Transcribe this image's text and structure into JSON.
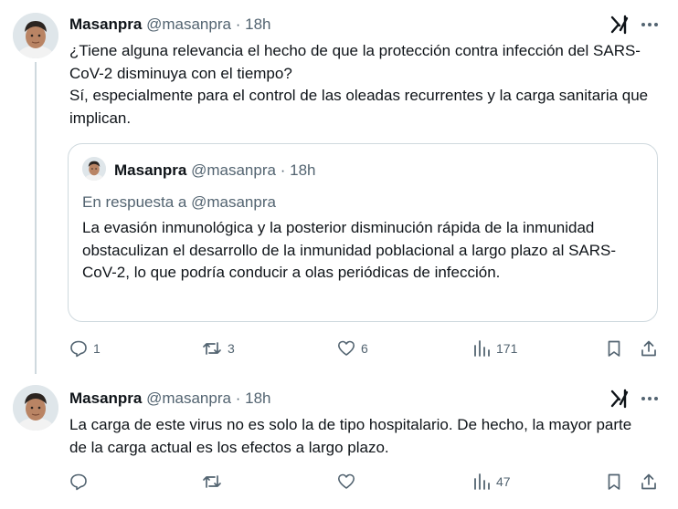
{
  "tweets": [
    {
      "name": "Masanpra",
      "handle": "@masanpra",
      "separator": "·",
      "time": "18h",
      "paragraphs": [
        "¿Tiene alguna relevancia el hecho de que la protección contra infección del SARS-CoV-2 disminuya con el tiempo?",
        "Sí, especialmente para el control de las oleadas recurrentes y la carga sanitaria que implican."
      ],
      "quote": {
        "name": "Masanpra",
        "handle": "@masanpra",
        "separator": "·",
        "time": "18h",
        "reply_prefix": "En respuesta a ",
        "reply_to": "@masanpra",
        "text": "La evasión inmunológica y la posterior disminución rápida de la inmunidad obstaculizan el desarrollo de la inmunidad poblacional a largo plazo al SARS-CoV-2, lo que podría conducir a olas periódicas de infección."
      },
      "actions": {
        "replies": "1",
        "reposts": "3",
        "likes": "6",
        "views": "171"
      }
    },
    {
      "name": "Masanpra",
      "handle": "@masanpra",
      "separator": "·",
      "time": "18h",
      "paragraphs": [
        "La carga de este virus no es solo la de tipo hospitalario. De hecho, la mayor parte de la carga actual es los efectos a largo plazo."
      ],
      "actions": {
        "replies": "",
        "reposts": "",
        "likes": "",
        "views": "47"
      }
    }
  ],
  "icons": [
    "grok-icon",
    "more-icon",
    "reply-icon",
    "repost-icon",
    "like-icon",
    "views-icon",
    "bookmark-icon",
    "share-icon"
  ],
  "colors": {
    "text": "#0f1419",
    "secondary": "#536471",
    "border": "#cfd9de"
  }
}
